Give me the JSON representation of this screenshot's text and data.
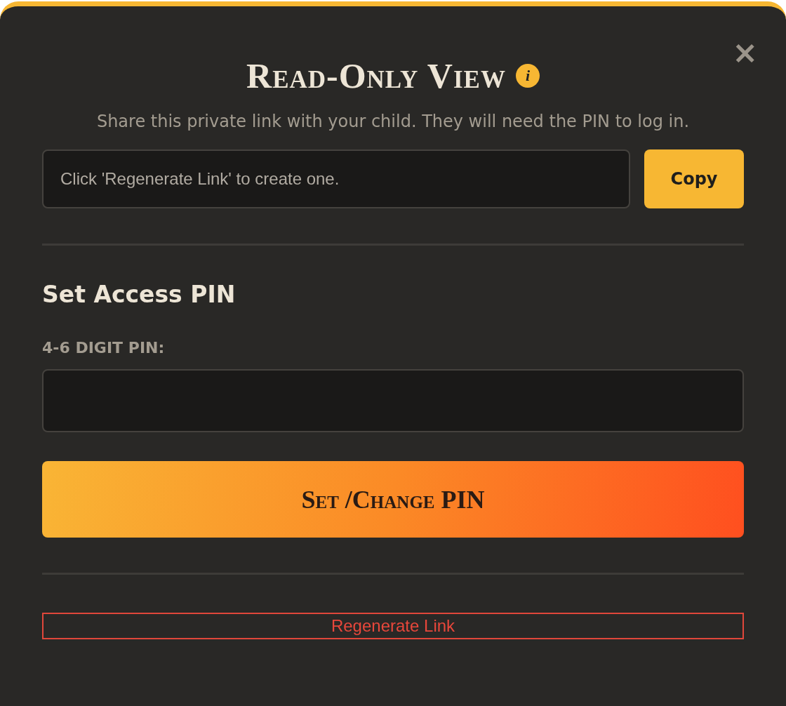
{
  "dialog": {
    "title": "Read-Only View",
    "info_icon": "i",
    "close": "×",
    "subtitle": "Share this private link with your child. They will need the PIN to log in."
  },
  "link": {
    "placeholder": "Click 'Regenerate Link' to create one.",
    "copy_button": "Copy"
  },
  "pin_section": {
    "heading": "Set Access PIN",
    "label": "4-6 DIGIT PIN:",
    "submit_button": "Set /Change PIN"
  },
  "regenerate_button": "Regenerate Link"
}
